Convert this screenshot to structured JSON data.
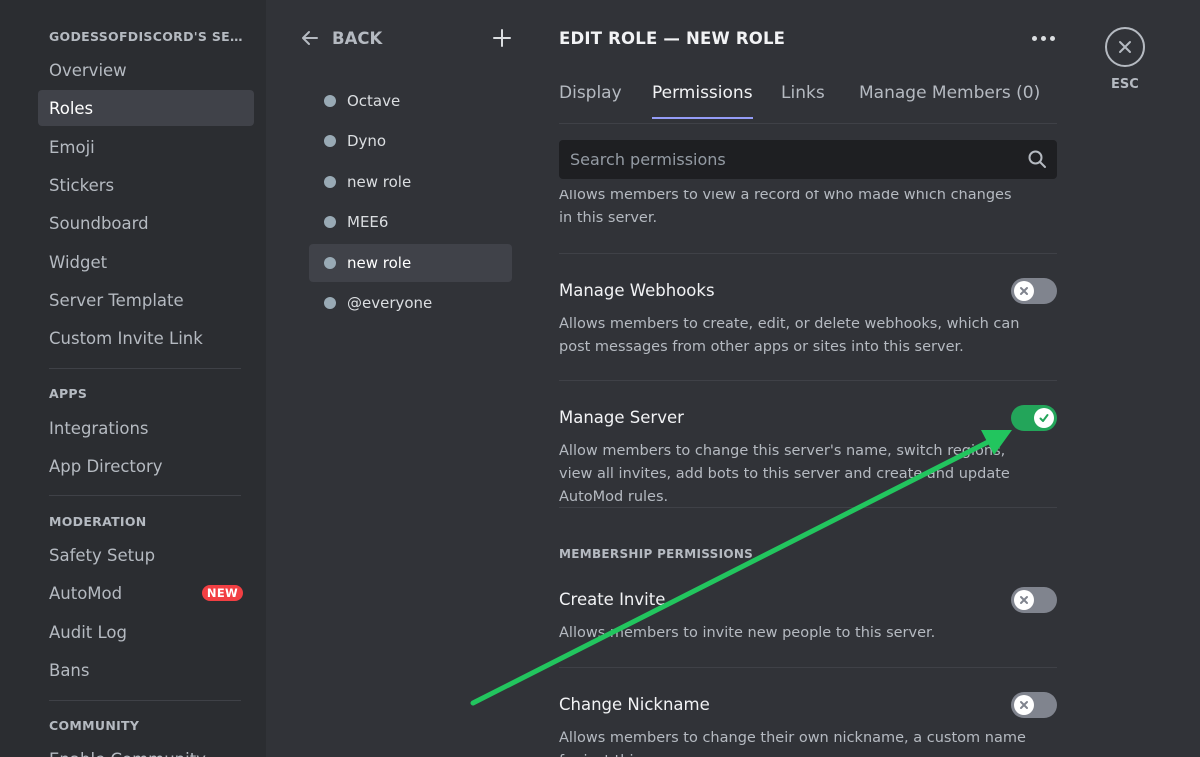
{
  "sidebar": {
    "server_header": "GODESSOFDISCORD'S SERVER",
    "items": [
      {
        "label": "Overview"
      },
      {
        "label": "Roles",
        "active": true
      },
      {
        "label": "Emoji"
      },
      {
        "label": "Stickers"
      },
      {
        "label": "Soundboard"
      },
      {
        "label": "Widget"
      },
      {
        "label": "Server Template"
      },
      {
        "label": "Custom Invite Link"
      }
    ],
    "apps_header": "APPS",
    "apps_items": [
      {
        "label": "Integrations"
      },
      {
        "label": "App Directory"
      }
    ],
    "moderation_header": "MODERATION",
    "moderation_items": [
      {
        "label": "Safety Setup"
      },
      {
        "label": "AutoMod",
        "badge": "NEW"
      },
      {
        "label": "Audit Log"
      },
      {
        "label": "Bans"
      }
    ],
    "community_header": "COMMUNITY",
    "community_items": [
      {
        "label": "Enable Community"
      }
    ]
  },
  "roles_panel": {
    "back_label": "BACK",
    "roles": [
      {
        "name": "Octave"
      },
      {
        "name": "Dyno"
      },
      {
        "name": "new role"
      },
      {
        "name": "MEE6"
      },
      {
        "name": "new role",
        "active": true
      },
      {
        "name": "@everyone"
      }
    ]
  },
  "editor": {
    "title": "EDIT ROLE — NEW ROLE",
    "tabs": [
      {
        "label": "Display"
      },
      {
        "label": "Permissions",
        "active": true
      },
      {
        "label": "Links"
      },
      {
        "label": "Manage Members (0)"
      }
    ],
    "search_placeholder": "Search permissions",
    "partial_desc": "Allows members to view a record of who made which changes in this server.",
    "permissions": [
      {
        "title": "Manage Webhooks",
        "description": "Allows members to create, edit, or delete webhooks, which can post messages from other apps or sites into this server.",
        "enabled": false
      },
      {
        "title": "Manage Server",
        "description": "Allow members to change this server's name, switch regions, view all invites, add bots to this server and create and update AutoMod rules.",
        "enabled": true
      }
    ],
    "membership_header": "MEMBERSHIP PERMISSIONS",
    "membership_permissions": [
      {
        "title": "Create Invite",
        "description": "Allows members to invite new people to this server.",
        "enabled": false
      },
      {
        "title": "Change Nickname",
        "description": "Allows members to change their own nickname, a custom name for just this server.",
        "enabled": false
      }
    ]
  },
  "close": {
    "label": "ESC"
  },
  "colors": {
    "accent_tab": "#949cf7",
    "toggle_on": "#23a55a",
    "toggle_off": "#80848e",
    "annotation_arrow": "#22c55e",
    "badge_red": "#f23f43"
  },
  "icons": {
    "back": "arrow-left-icon",
    "add": "plus-icon",
    "more": "ellipsis-icon",
    "search": "magnifier-icon",
    "close": "x-circle-icon",
    "toggle_off": "x-icon",
    "toggle_on": "check-icon"
  }
}
